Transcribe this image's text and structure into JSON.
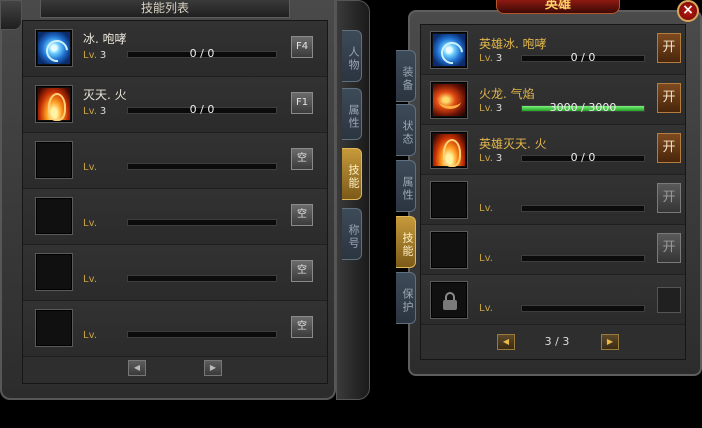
{
  "left_panel": {
    "title": "技能列表",
    "tabs": [
      {
        "label": "人物",
        "active": false
      },
      {
        "label": "属性",
        "active": false
      },
      {
        "label": "技能",
        "active": true
      },
      {
        "label": "称号",
        "active": false
      }
    ],
    "skills": [
      {
        "name": "冰. 咆哮",
        "lv_label": "Lv.",
        "level": "3",
        "progress": "0 / 0",
        "key": "F4",
        "icon": "ice-icon"
      },
      {
        "name": "灭天. 火",
        "lv_label": "Lv.",
        "level": "3",
        "progress": "0 / 0",
        "key": "F1",
        "icon": "fire-icon"
      },
      {
        "name": "",
        "lv_label": "Lv.",
        "level": "",
        "progress": "",
        "key": "空",
        "icon": ""
      },
      {
        "name": "",
        "lv_label": "Lv.",
        "level": "",
        "progress": "",
        "key": "空",
        "icon": ""
      },
      {
        "name": "",
        "lv_label": "Lv.",
        "level": "",
        "progress": "",
        "key": "空",
        "icon": ""
      },
      {
        "name": "",
        "lv_label": "Lv.",
        "level": "",
        "progress": "",
        "key": "空",
        "icon": ""
      }
    ],
    "pager": {
      "prev": "◀",
      "next": "▶"
    }
  },
  "right_panel": {
    "title": "英雄",
    "close": "×",
    "tabs": [
      {
        "label": "装备",
        "active": false
      },
      {
        "label": "状态",
        "active": false
      },
      {
        "label": "属性",
        "active": false
      },
      {
        "label": "技能",
        "active": true
      },
      {
        "label": "保护",
        "active": false
      }
    ],
    "skills": [
      {
        "name": "英雄冰. 咆哮",
        "lv_label": "Lv.",
        "level": "3",
        "progress": "0 / 0",
        "fill": 0,
        "button": "开",
        "icon": "ice-icon"
      },
      {
        "name": "火龙. 气焰",
        "lv_label": "Lv.",
        "level": "3",
        "progress": "3000 / 3000",
        "fill": 1.0,
        "button": "开",
        "icon": "dragon-icon"
      },
      {
        "name": "英雄灭天. 火",
        "lv_label": "Lv.",
        "level": "3",
        "progress": "0 / 0",
        "fill": 0,
        "button": "开",
        "icon": "fire-icon"
      },
      {
        "name": "",
        "lv_label": "Lv.",
        "level": "",
        "progress": "",
        "fill": 0,
        "button": "开",
        "icon": ""
      },
      {
        "name": "",
        "lv_label": "Lv.",
        "level": "",
        "progress": "",
        "fill": 0,
        "button": "开",
        "icon": ""
      },
      {
        "name": "",
        "lv_label": "Lv.",
        "level": "",
        "progress": "",
        "fill": 0,
        "button": "",
        "icon": "lock-icon"
      }
    ],
    "pager": {
      "prev": "◀",
      "next": "▶",
      "page": "3 / 3"
    }
  }
}
